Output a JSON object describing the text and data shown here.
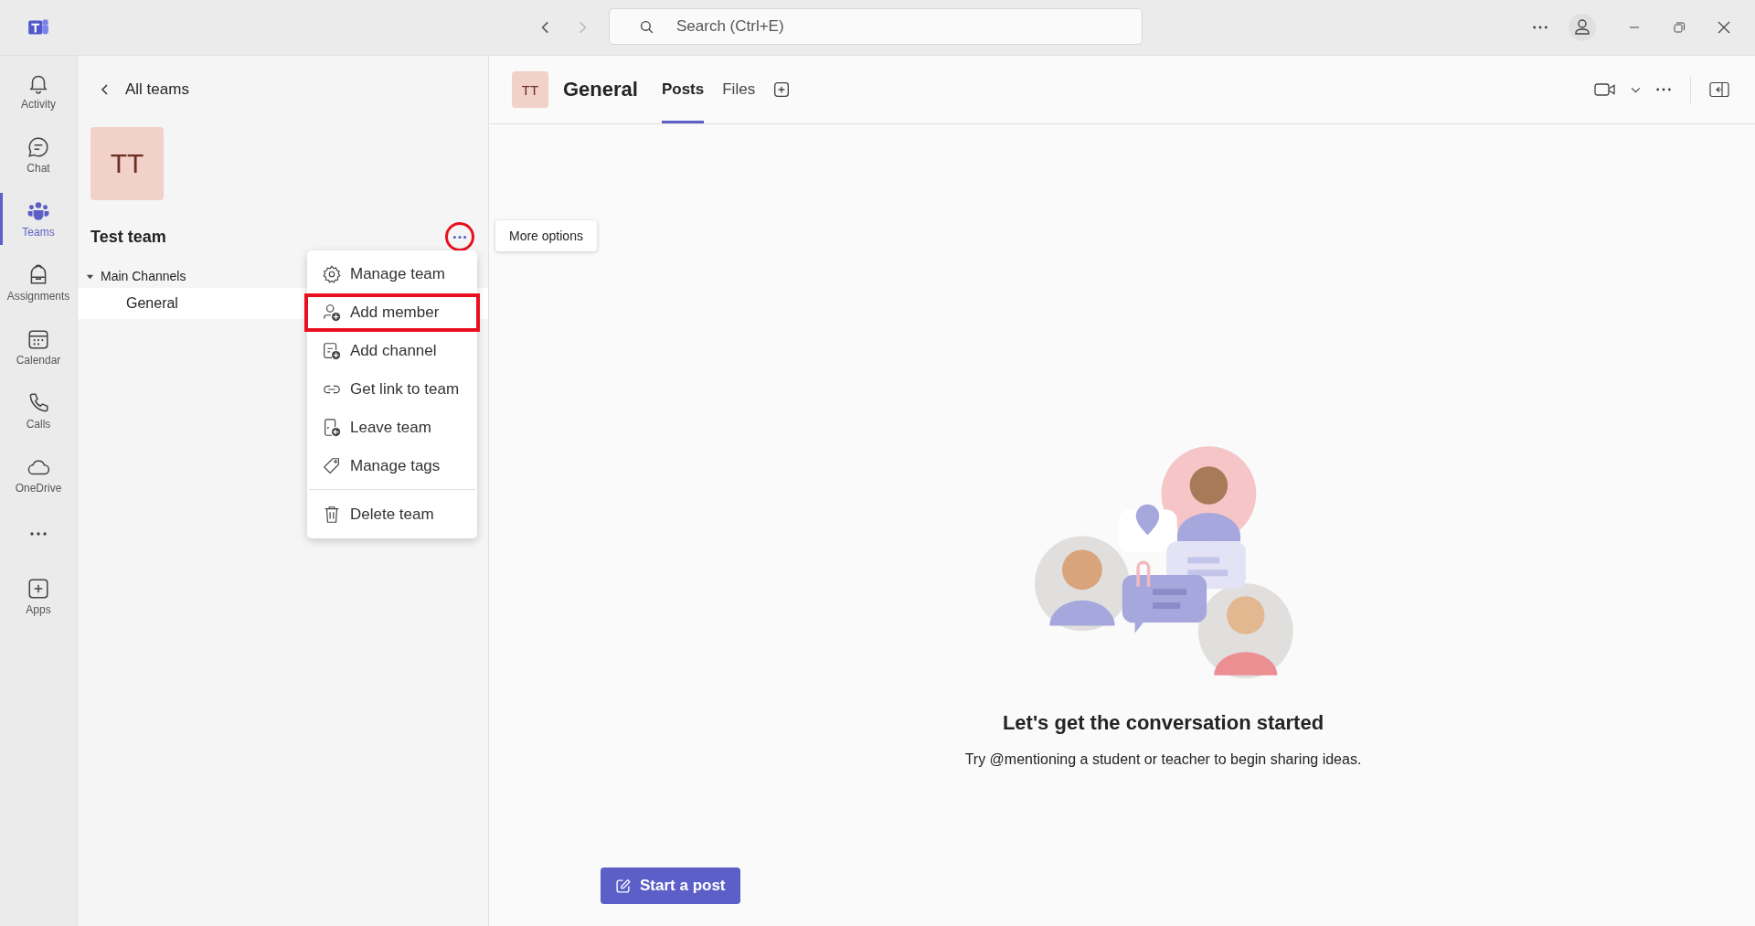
{
  "title_bar": {
    "search": {
      "placeholder": "Search (Ctrl+E)"
    }
  },
  "rail": {
    "items": [
      {
        "label": "Activity",
        "selected": false
      },
      {
        "label": "Chat",
        "selected": false
      },
      {
        "label": "Teams",
        "selected": true
      },
      {
        "label": "Assignments",
        "selected": false
      },
      {
        "label": "Calendar",
        "selected": false
      },
      {
        "label": "Calls",
        "selected": false
      },
      {
        "label": "OneDrive",
        "selected": false
      }
    ],
    "bottom_items": [
      {
        "label": "Apps",
        "selected": false
      }
    ]
  },
  "team_panel": {
    "back_label": "All teams",
    "avatar": "TT",
    "team_name": "Test team",
    "more_button": {
      "highlighted": true
    },
    "tooltip": "More options",
    "channel_groups": [
      {
        "label": "Main Channels",
        "expanded": true,
        "children": [
          {
            "label": "General",
            "selected": true
          }
        ]
      }
    ]
  },
  "menu": {
    "groups": [
      [
        {
          "label": "Manage team",
          "highlighted": false
        },
        {
          "label": "Add member",
          "highlighted": true
        },
        {
          "label": "Add channel",
          "highlighted": false
        },
        {
          "label": "Get link to team",
          "highlighted": false
        },
        {
          "label": "Leave team",
          "highlighted": false
        },
        {
          "label": "Manage tags",
          "highlighted": false
        }
      ],
      [
        {
          "label": "Delete team",
          "highlighted": false
        }
      ]
    ]
  },
  "channel_header": {
    "avatar": "TT",
    "title": "General",
    "tabs": [
      {
        "label": "Posts",
        "selected": true
      },
      {
        "label": "Files",
        "selected": false
      }
    ]
  },
  "empty_state": {
    "title": "Let's get the conversation started",
    "text": "Try @mentioning a student or teacher to begin sharing ideas.",
    "button": "Start a post"
  }
}
